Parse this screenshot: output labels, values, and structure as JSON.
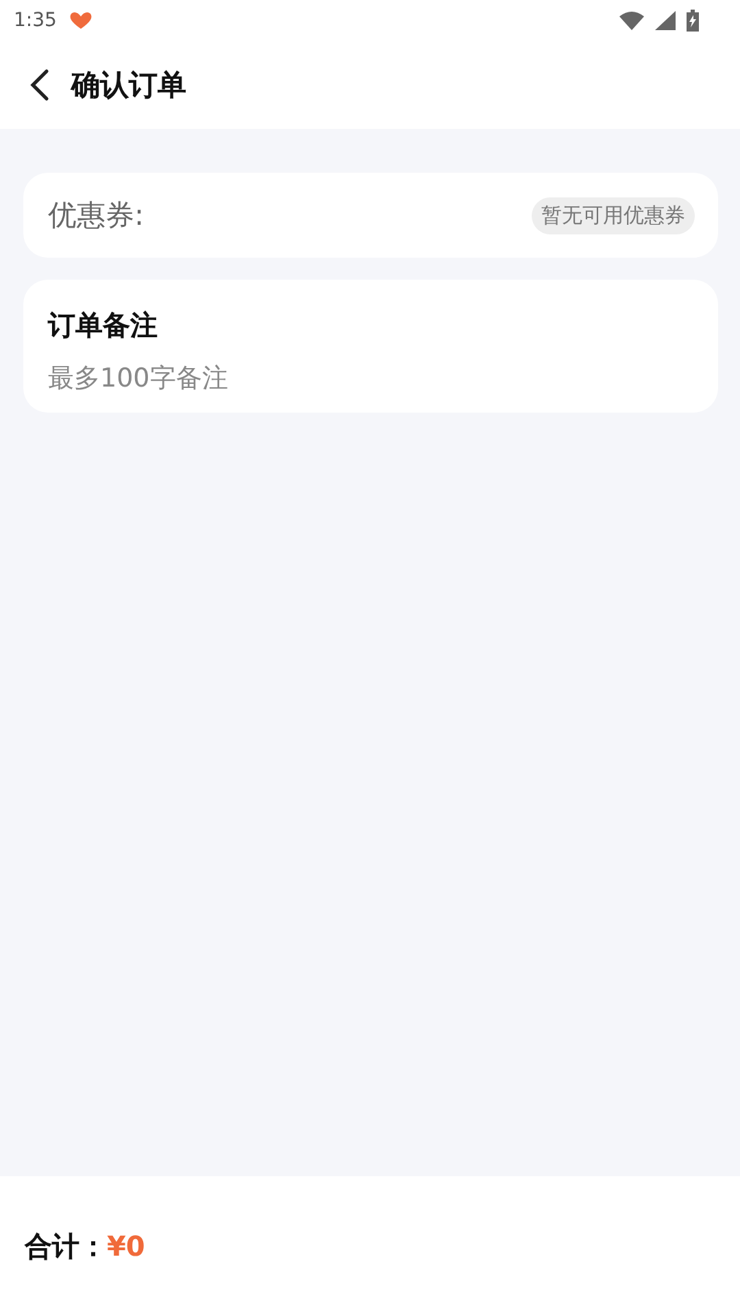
{
  "status_bar": {
    "time": "1:35"
  },
  "header": {
    "title": "确认订单"
  },
  "coupon": {
    "label": "优惠券:",
    "badge": "暂无可用优惠券"
  },
  "note": {
    "title": "订单备注",
    "placeholder": "最多100字备注"
  },
  "footer": {
    "label": "合计：",
    "amount": "¥0"
  }
}
